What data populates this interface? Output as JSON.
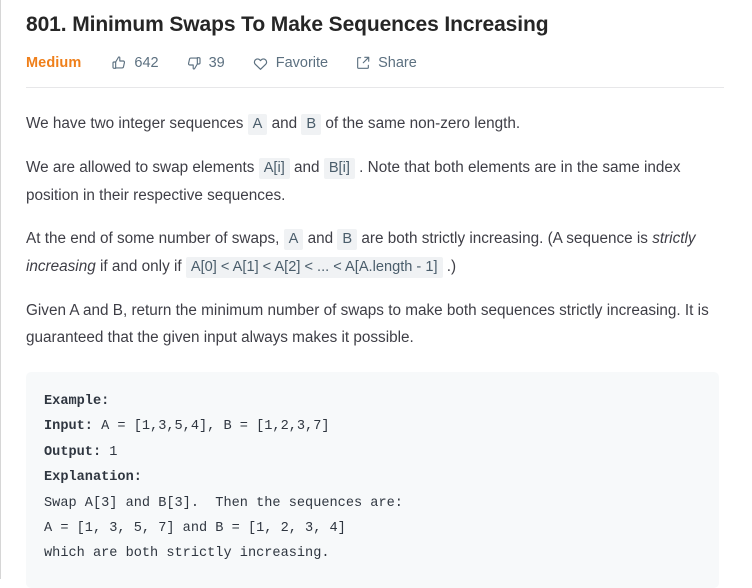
{
  "problem": {
    "title": "801. Minimum Swaps To Make Sequences Increasing",
    "difficulty": "Medium",
    "difficulty_color": "#ef7f1a"
  },
  "meta": {
    "likes": "642",
    "dislikes": "39",
    "favorite_label": "Favorite",
    "share_label": "Share",
    "icons": {
      "like": "thumbs-up-icon",
      "dislike": "thumbs-down-icon",
      "favorite": "heart-icon",
      "share": "share-icon"
    }
  },
  "description": {
    "p1": {
      "t1": "We have two integer sequences ",
      "c1": "A",
      "t2": " and ",
      "c2": "B",
      "t3": " of the same non-zero length."
    },
    "p2": {
      "t1": "We are allowed to swap elements ",
      "c1": "A[i]",
      "t2": " and ",
      "c2": "B[i]",
      "t3": " . Note that both elements are in the same index position in their respective sequences."
    },
    "p3": {
      "t1": "At the end of some number of swaps, ",
      "c1": "A",
      "t2": " and ",
      "c2": "B",
      "t3": " are both strictly increasing.  (A sequence is ",
      "em1": "strictly increasing",
      "t4": " if and only if ",
      "c3": "A[0] < A[1] < A[2] < ... < A[A.length - 1]",
      "t5": " .)"
    },
    "p4": {
      "t1": "Given A and B, return the minimum number of swaps to make both sequences strictly increasing.  It is guaranteed that the given input always makes it possible."
    }
  },
  "example_block": {
    "lines": [
      {
        "lead": "Example:",
        "rest": ""
      },
      {
        "lead": "Input:",
        "rest": " A = [1,3,5,4], B = [1,2,3,7]"
      },
      {
        "lead": "Output:",
        "rest": " 1"
      },
      {
        "lead": "Explanation:",
        "rest": ""
      },
      {
        "lead": "",
        "rest": "Swap A[3] and B[3].  Then the sequences are:"
      },
      {
        "lead": "",
        "rest": "A = [1, 3, 5, 7] and B = [1, 2, 3, 4]"
      },
      {
        "lead": "",
        "rest": "which are both strictly increasing."
      }
    ]
  }
}
